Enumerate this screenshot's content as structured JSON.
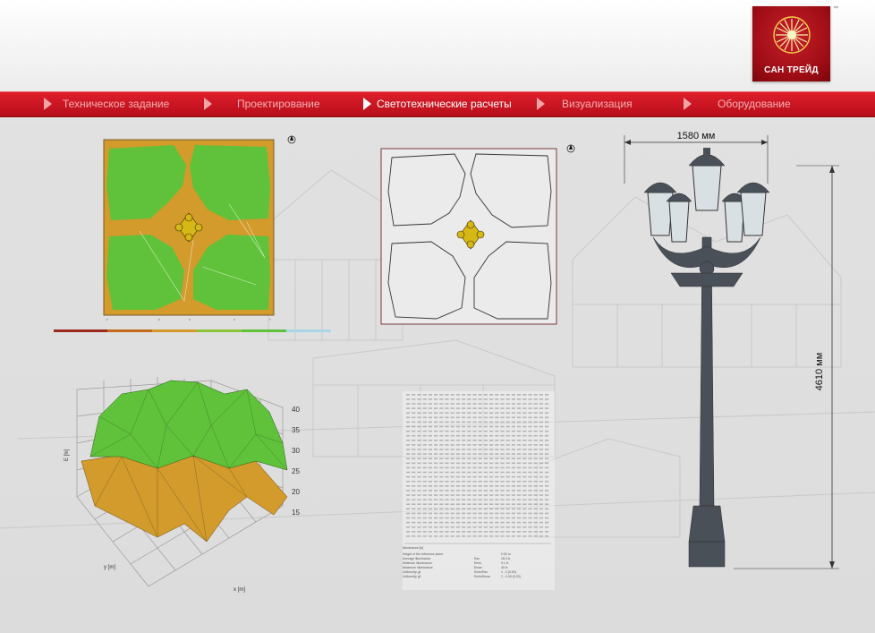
{
  "brand": {
    "name": "САН ТРЕЙД",
    "tm": "™"
  },
  "nav": {
    "items": [
      {
        "label": "Техническое задание",
        "active": false
      },
      {
        "label": "Проектирование",
        "active": false
      },
      {
        "label": "Светотехнические расчеты",
        "active": true
      },
      {
        "label": "Визуализация",
        "active": false
      },
      {
        "label": "Оборудование",
        "active": false
      }
    ]
  },
  "lamp": {
    "width_label": "1580 мм",
    "height_label": "4610 мм"
  },
  "surface_chart": {
    "z_ticks": [
      "40",
      "35",
      "30",
      "25",
      "20",
      "15"
    ],
    "z_label": "E [lx]",
    "y_label": "y [m]",
    "x_label": "x [m]"
  },
  "results_table": {
    "footer_axis_label": "Illuminance [lx]",
    "stats": [
      {
        "label": "Height of the reference plane",
        "value": "0.00 m"
      },
      {
        "label": "Average illuminance",
        "sym": "Eav",
        "value": "18.3 lx"
      },
      {
        "label": "Minimum illuminance",
        "sym": "Emin",
        "value": "9.1 lx"
      },
      {
        "label": "Maximum illuminance",
        "sym": "Emax",
        "value": "40 lx"
      },
      {
        "label": "Uniformity g1",
        "sym": "Emin/Eav",
        "value": "1 : 2 (0.50)"
      },
      {
        "label": "Uniformity g2",
        "sym": "Emin/Emax",
        "value": "1 : 4.39 (0.23)"
      }
    ]
  },
  "colors": {
    "nav_red": "#cc1722",
    "illum_green": "#5fc23a",
    "illum_orange": "#d39a2c",
    "lamp_dark": "#4a5058"
  }
}
